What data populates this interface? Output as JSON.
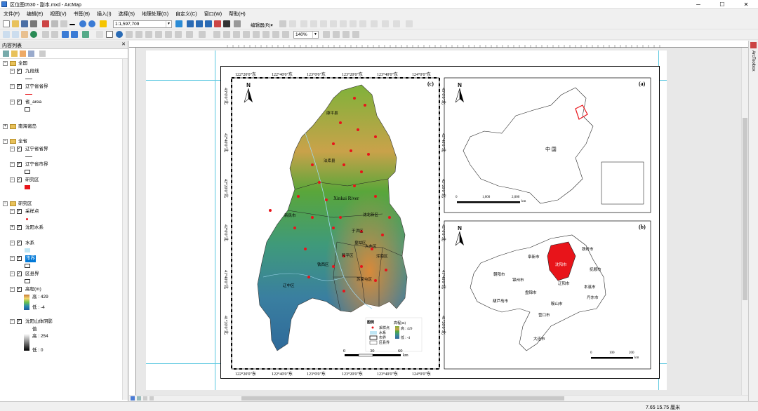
{
  "window": {
    "title": "区位图0530 - 副本.mxd - ArcMap",
    "minimize": "─",
    "maximize": "☐",
    "close": "✕"
  },
  "menu": [
    "文件(F)",
    "编辑(E)",
    "视图(V)",
    "书签(B)",
    "插入(I)",
    "选择(S)",
    "地理处理(G)",
    "自定义(C)",
    "窗口(W)",
    "帮助(H)"
  ],
  "toolbar": {
    "scale": "1:1,597,709",
    "editor_label": "编辑器(R)▾",
    "zoom": "140%"
  },
  "toc": {
    "title": "内容列表",
    "close": "✕",
    "items": [
      {
        "level": 0,
        "type": "group",
        "label": "全国"
      },
      {
        "level": 1,
        "type": "layer",
        "label": "九段线"
      },
      {
        "level": 1,
        "type": "layer",
        "label": "辽宁省省界"
      },
      {
        "level": 1,
        "type": "layer",
        "label": "省_area"
      },
      {
        "level": 0,
        "type": "group",
        "label": "南海诸岛"
      },
      {
        "level": 0,
        "type": "group",
        "label": "全省"
      },
      {
        "level": 1,
        "type": "layer",
        "label": "辽宁省省界"
      },
      {
        "level": 1,
        "type": "layer",
        "label": "辽宁省市界"
      },
      {
        "level": 1,
        "type": "layer",
        "label": "研究区"
      },
      {
        "level": 0,
        "type": "group",
        "label": "研究区"
      },
      {
        "level": 1,
        "type": "layer",
        "label": "采样点"
      },
      {
        "level": 1,
        "type": "layer",
        "label": "沈阳水系"
      },
      {
        "level": 1,
        "type": "layer",
        "label": "水系"
      },
      {
        "level": 1,
        "type": "layer",
        "label": "市界",
        "selected": true
      },
      {
        "level": 1,
        "type": "layer",
        "label": "区县界"
      },
      {
        "level": 1,
        "type": "layer",
        "label": "高程(m)"
      },
      {
        "level": 1,
        "type": "layer",
        "label": "沈阳山体阴影"
      }
    ],
    "elev_high": "高 : 429",
    "elev_low": "低 : -4",
    "hill_value": "值",
    "hill_high": "高 : 254",
    "hill_low": "低 : 0"
  },
  "map": {
    "panel_c": "(c)",
    "panel_a": "(a)",
    "panel_b": "(b)",
    "north": "N",
    "top_lon": [
      "122°20'0\"东",
      "122°40'0\"东",
      "123°0'0\"东",
      "123°20'0\"东",
      "123°40'0\"东",
      "124°0'0\"东"
    ],
    "bottom_lon": [
      "122°20'0\"东",
      "122°40'0\"东",
      "123°0'0\"东",
      "123°20'0\"东",
      "123°40'0\"东",
      "124°0'0\"东"
    ],
    "left_lat": [
      "43°0'0\"北",
      "42°40'0\"北",
      "42°20'0\"北",
      "42°0'0\"北",
      "41°40'0\"北",
      "41°20'0\"北"
    ],
    "right_lat": [
      "43°0'0\"北",
      "42°40'0\"北",
      "42°20'0\"北",
      "42°0'0\"北",
      "41°40'0\"北",
      "41°20'0\"北"
    ],
    "labels_c": [
      "康平县",
      "法库县",
      "新民市",
      "沈北新区",
      "于洪区",
      "皇姑区",
      "大东区",
      "铁西区",
      "和平区",
      "浑南区",
      "辽中区",
      "苏家屯区",
      "Xinkai River"
    ],
    "legend": {
      "title": "图例",
      "sample": "采样点",
      "water": "水系",
      "city": "市界",
      "county": "区县界",
      "elev": "高程(m)",
      "high": "高 : 429",
      "low": "低 : -4"
    },
    "scale_c": [
      "0",
      "30",
      "60",
      "km"
    ],
    "china_label": "中 国",
    "scale_a": [
      "0",
      "1,000",
      "2,000",
      "km"
    ],
    "liaoning_cities": [
      "铁岭市",
      "阜新市",
      "沈阳市",
      "抚顺市",
      "朝阳市",
      "锦州市",
      "辽阳市",
      "本溪市",
      "盘锦市",
      "鞍山市",
      "葫芦岛市",
      "丹东市",
      "营口市",
      "大连市"
    ],
    "scale_b": [
      "0",
      "100",
      "200",
      "km"
    ]
  },
  "status": {
    "coords": "7.65  15.75 厘米"
  },
  "right_tab": "ArcToolbox",
  "colors": {
    "study_red": "#e8141a",
    "border_blue": "#1d4f99"
  }
}
